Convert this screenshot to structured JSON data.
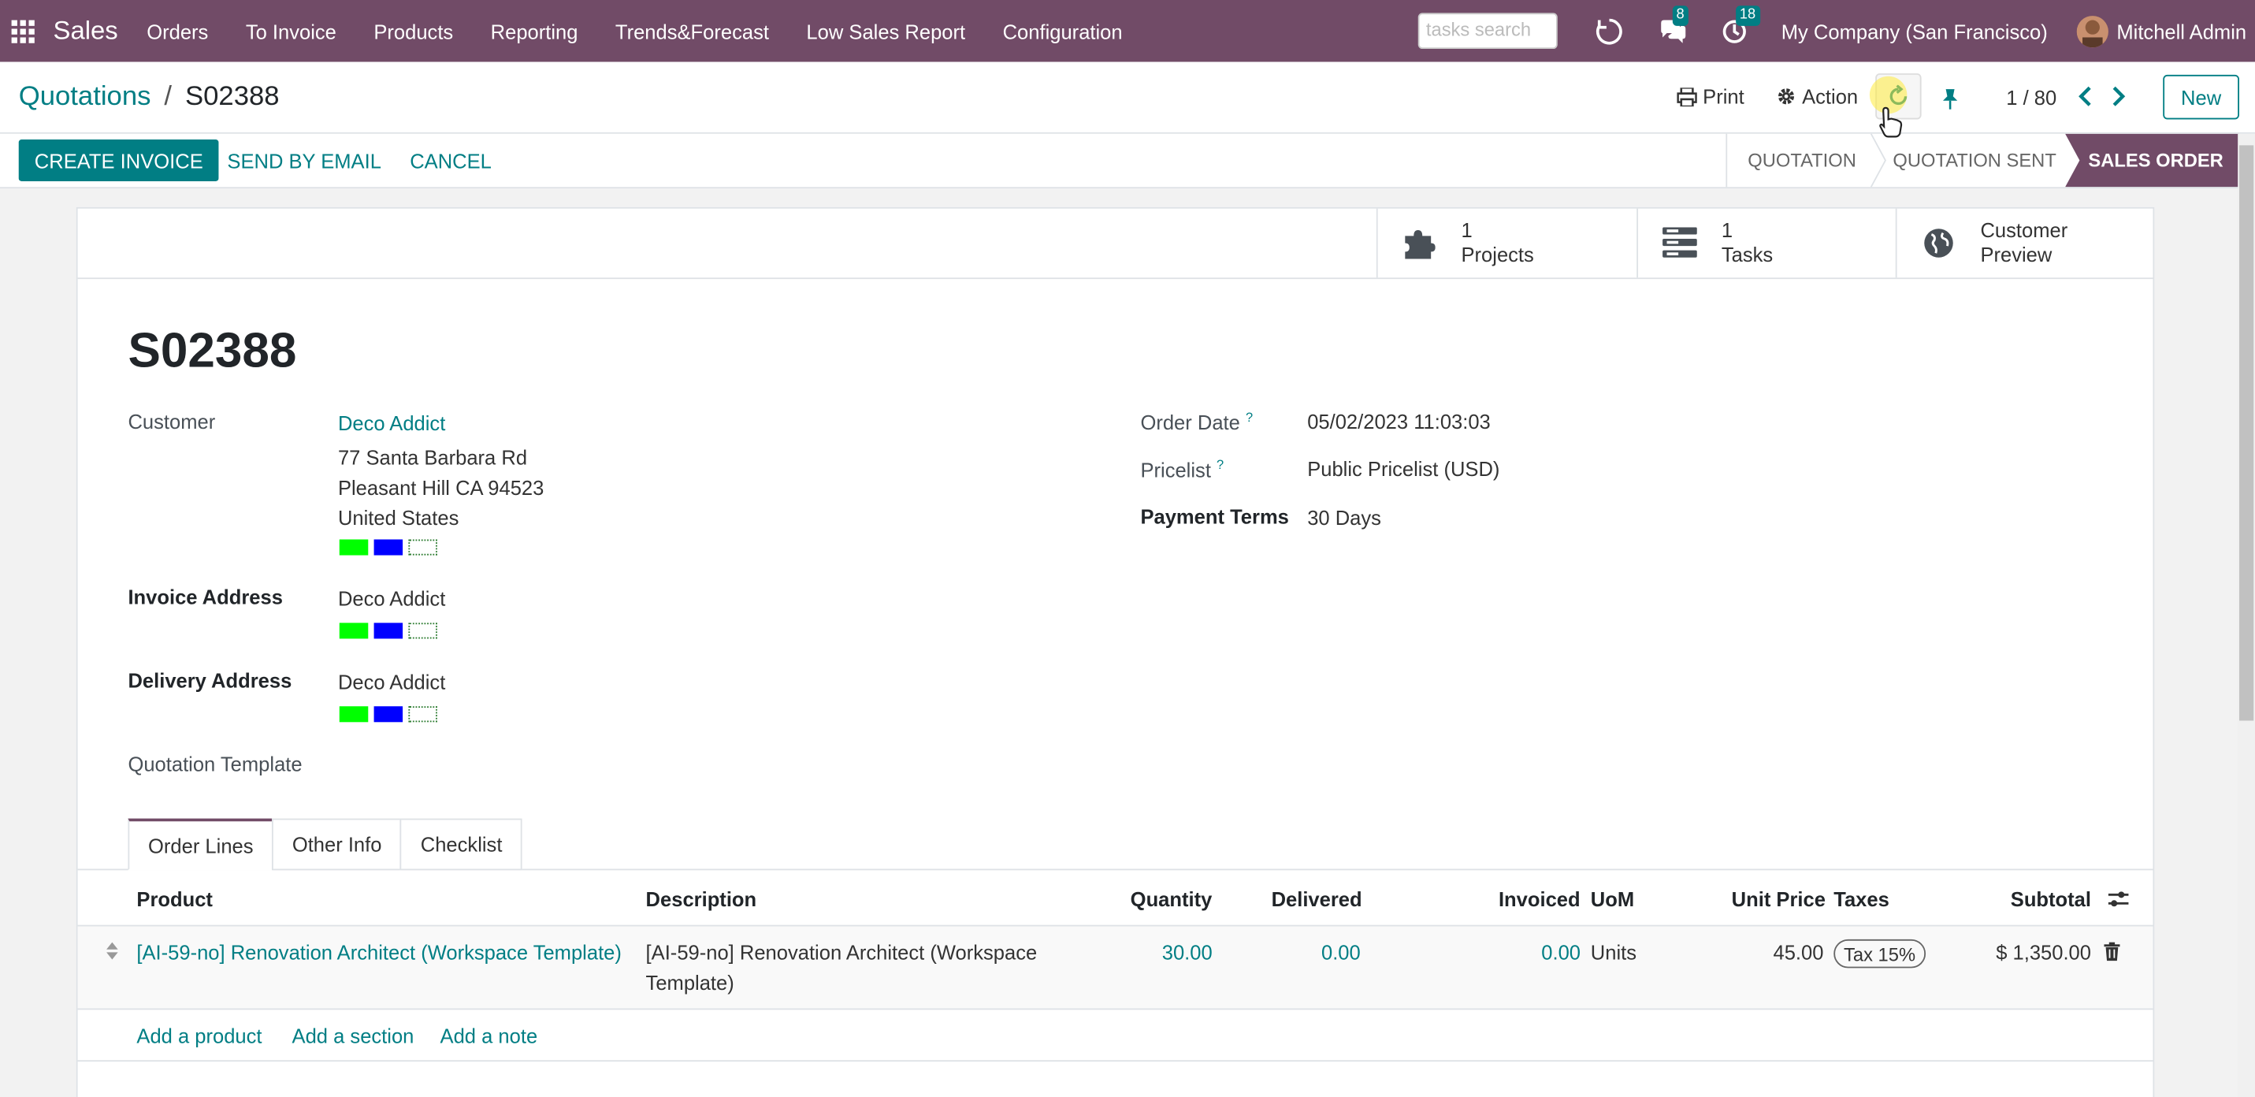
{
  "navbar": {
    "app_name": "Sales",
    "menu": [
      "Orders",
      "To Invoice",
      "Products",
      "Reporting",
      "Trends&Forecast",
      "Low Sales Report",
      "Configuration"
    ],
    "search_placeholder": "tasks search",
    "messages_count": "8",
    "activities_count": "18",
    "company": "My Company (San Francisco)",
    "user": "Mitchell Admin"
  },
  "control": {
    "breadcrumb_parent": "Quotations",
    "breadcrumb_sep": "/",
    "breadcrumb_current": "S02388",
    "print": "Print",
    "action": "Action",
    "pager": "1 / 80",
    "new": "New"
  },
  "statusbar": {
    "create_invoice": "CREATE INVOICE",
    "send_email": "SEND BY EMAIL",
    "cancel": "CANCEL",
    "stages": [
      "QUOTATION",
      "QUOTATION SENT",
      "SALES ORDER"
    ],
    "active_stage": "SALES ORDER"
  },
  "smart_buttons": {
    "projects_count": "1",
    "projects_label": "Projects",
    "tasks_count": "1",
    "tasks_label": "Tasks",
    "preview_line1": "Customer",
    "preview_line2": "Preview"
  },
  "record": {
    "name": "S02388",
    "customer_label": "Customer",
    "customer_name": "Deco Addict",
    "address_line1": "77 Santa Barbara Rd",
    "address_line2": "Pleasant Hill CA 94523",
    "address_line3": "United States",
    "invoice_address_label": "Invoice Address",
    "invoice_address": "Deco Addict",
    "delivery_address_label": "Delivery Address",
    "delivery_address": "Deco Addict",
    "quotation_template_label": "Quotation Template",
    "order_date_label": "Order Date",
    "order_date": "05/02/2023 11:03:03",
    "pricelist_label": "Pricelist",
    "pricelist": "Public Pricelist (USD)",
    "payment_terms_label": "Payment Terms",
    "payment_terms": "30 Days",
    "help_mark": "?"
  },
  "tabs": [
    "Order Lines",
    "Other Info",
    "Checklist"
  ],
  "table": {
    "headers": {
      "product": "Product",
      "description": "Description",
      "quantity": "Quantity",
      "delivered": "Delivered",
      "invoiced": "Invoiced",
      "uom": "UoM",
      "unit_price": "Unit Price",
      "taxes": "Taxes",
      "subtotal": "Subtotal"
    },
    "rows": [
      {
        "product": "[AI-59-no] Renovation Architect (Workspace Template)",
        "description_line1": "[AI-59-no] Renovation Architect (Workspace",
        "description_line2": "Template)",
        "quantity": "30.00",
        "delivered": "0.00",
        "invoiced": "0.00",
        "uom": "Units",
        "unit_price": "45.00",
        "tax": "Tax 15%",
        "subtotal": "$ 1,350.00"
      }
    ],
    "add_product": "Add a product",
    "add_section": "Add a section",
    "add_note": "Add a note"
  },
  "colors": {
    "brand": "#714b67",
    "accent": "#017e84"
  }
}
